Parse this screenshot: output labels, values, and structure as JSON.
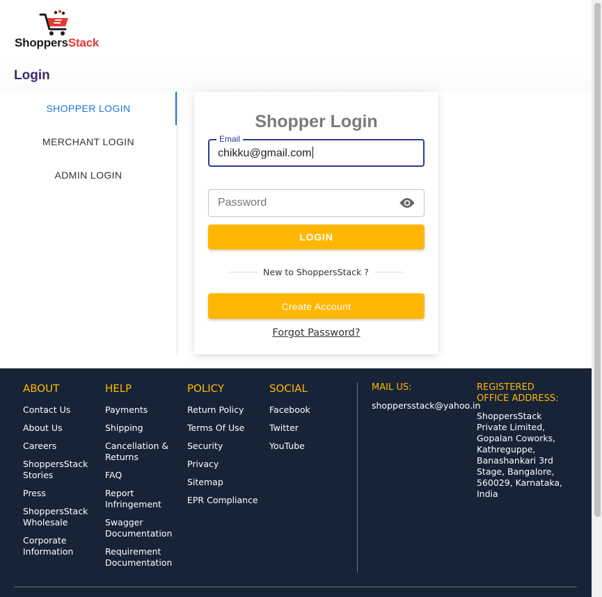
{
  "brand": {
    "part1": "Shoppers",
    "part2": "Stack"
  },
  "page_title": "Login",
  "tabs": [
    {
      "label": "SHOPPER LOGIN",
      "active": true
    },
    {
      "label": "MERCHANT LOGIN",
      "active": false
    },
    {
      "label": "ADMIN LOGIN",
      "active": false
    }
  ],
  "login_card": {
    "title": "Shopper Login",
    "email_label": "Email",
    "email_value": "chikku@gmail.com",
    "password_placeholder": "Password",
    "login_button": "LOGIN",
    "new_to": "New to ShoppersStack ?",
    "create_account_button": "Create Account",
    "forgot_password": "Forgot Password?"
  },
  "footer": {
    "about": {
      "heading": "ABOUT",
      "links": [
        "Contact Us",
        "About Us",
        "Careers",
        "ShoppersStack Stories",
        "Press",
        "ShoppersStack Wholesale",
        "Corporate Information"
      ]
    },
    "help": {
      "heading": "HELP",
      "links": [
        "Payments",
        "Shipping",
        "Cancellation & Returns",
        "FAQ",
        "Report Infringement",
        "Swagger Documentation",
        "Requirement Documentation"
      ]
    },
    "policy": {
      "heading": "POLICY",
      "links": [
        "Return Policy",
        "Terms Of Use",
        "Security",
        "Privacy",
        "Sitemap",
        "EPR Compliance"
      ]
    },
    "social": {
      "heading": "SOCIAL",
      "links": [
        "Facebook",
        "Twitter",
        "YouTube"
      ]
    },
    "mail": {
      "heading": "MAIL US:",
      "email": "shoppersstack@yahoo.in"
    },
    "office": {
      "heading": "REGISTERED OFFICE ADDRESS:",
      "address": "ShoppersStack Private Limited, Gopalan Coworks, Kathreguppe, Banashankari 3rd Stage, Bangalore, 560029, Karnataka, India"
    }
  },
  "colors": {
    "accent": "#ffb703",
    "tab_active": "#1976d2",
    "footer_bg": "#172337",
    "title": "#3a2a6e",
    "brand_red": "#e53935"
  }
}
